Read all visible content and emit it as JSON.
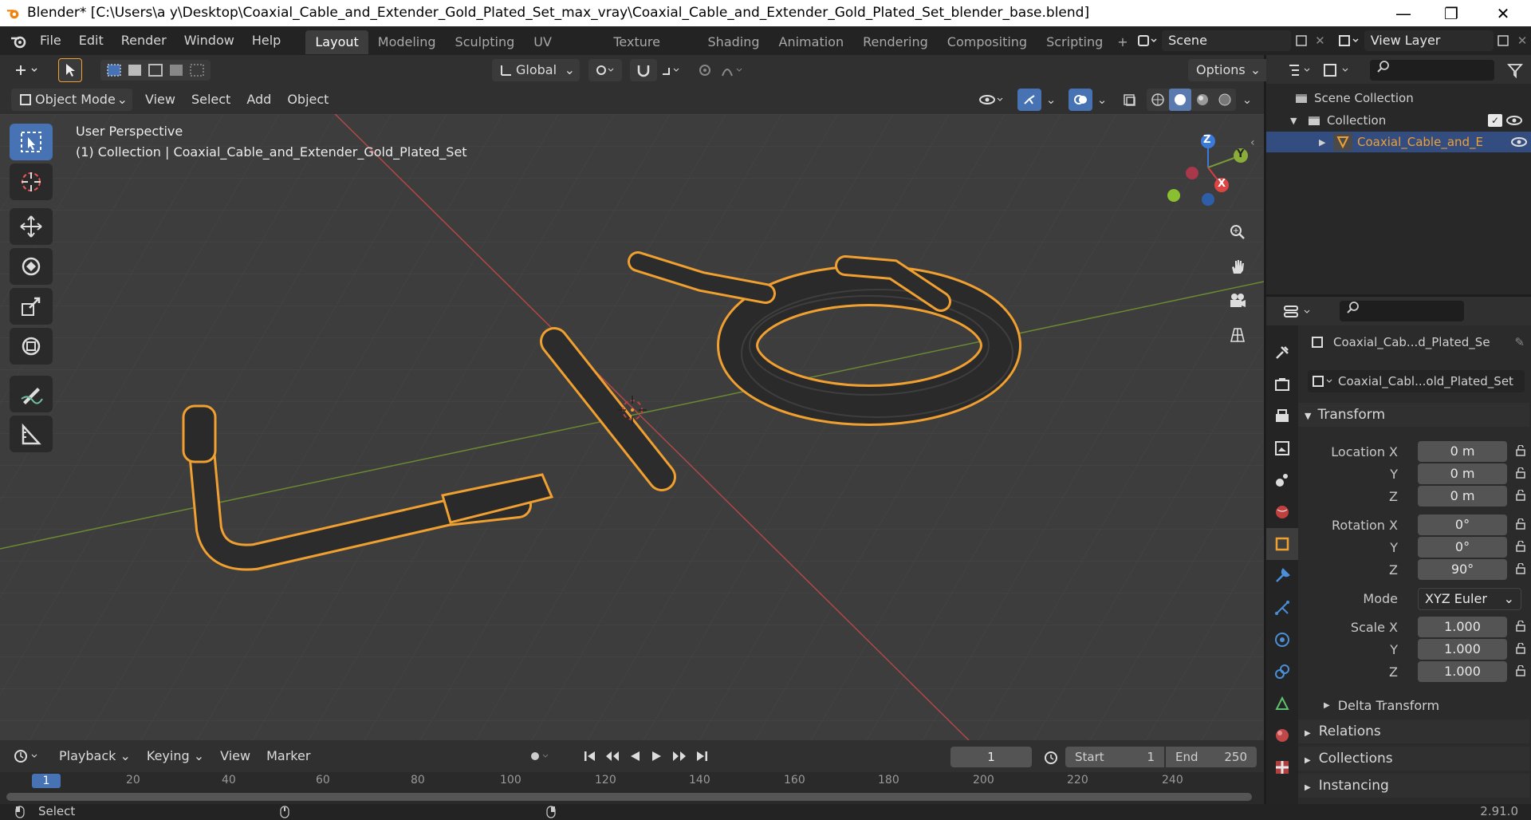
{
  "window": {
    "title": "Blender* [C:\\Users\\a y\\Desktop\\Coaxial_Cable_and_Extender_Gold_Plated_Set_max_vray\\Coaxial_Cable_and_Extender_Gold_Plated_Set_blender_base.blend]",
    "minimize": "—",
    "maximize": "❐",
    "close": "✕"
  },
  "menu": [
    "File",
    "Edit",
    "Render",
    "Window",
    "Help"
  ],
  "workspaces": [
    "Layout",
    "Modeling",
    "Sculpting",
    "UV Editing",
    "Texture Paint",
    "Shading",
    "Animation",
    "Rendering",
    "Compositing",
    "Scripting"
  ],
  "scene": {
    "name": "Scene",
    "view_layer": "View Layer"
  },
  "toolheader": {
    "orientation": "Global",
    "options": "Options"
  },
  "viewheader": {
    "mode": "Object Mode",
    "items": [
      "View",
      "Select",
      "Add",
      "Object"
    ]
  },
  "viewport": {
    "perspective": "User Perspective",
    "collection_info": "(1) Collection | Coaxial_Cable_and_Extender_Gold_Plated_Set",
    "gizmo": {
      "z": "Z",
      "y": "Y",
      "x": "X"
    }
  },
  "outliner": {
    "root": "Scene Collection",
    "collection": "Collection",
    "object": "Coaxial_Cable_and_E"
  },
  "properties": {
    "object_name": "Coaxial_Cab...d_Plated_Se",
    "data_name": "Coaxial_Cabl...old_Plated_Set",
    "transform_title": "Transform",
    "location_label": "Location X",
    "loc_x": "0 m",
    "loc_y": "0 m",
    "loc_z": "0 m",
    "rotation_label": "Rotation X",
    "rot_x": "0°",
    "rot_y": "0°",
    "rot_z": "90°",
    "mode_label": "Mode",
    "mode_value": "XYZ Euler",
    "scale_label": "Scale X",
    "scale_x": "1.000",
    "scale_y": "1.000",
    "scale_z": "1.000",
    "y": "Y",
    "z": "Z",
    "delta": "Delta Transform",
    "relations": "Relations",
    "collections": "Collections",
    "instancing": "Instancing"
  },
  "timeline": {
    "menus": [
      "Playback",
      "Keying",
      "View",
      "Marker"
    ],
    "current_frame": "1",
    "start_label": "Start",
    "start": "1",
    "end_label": "End",
    "end": "250",
    "ticks": [
      "1",
      "20",
      "40",
      "60",
      "80",
      "100",
      "120",
      "140",
      "160",
      "180",
      "200",
      "220",
      "240"
    ]
  },
  "status": {
    "select": "Select",
    "version": "2.91.0"
  },
  "colors": {
    "accent": "#4772b3",
    "selection": "#f0a030",
    "x_axis": "#d04040",
    "y_axis": "#7a9a3a"
  }
}
